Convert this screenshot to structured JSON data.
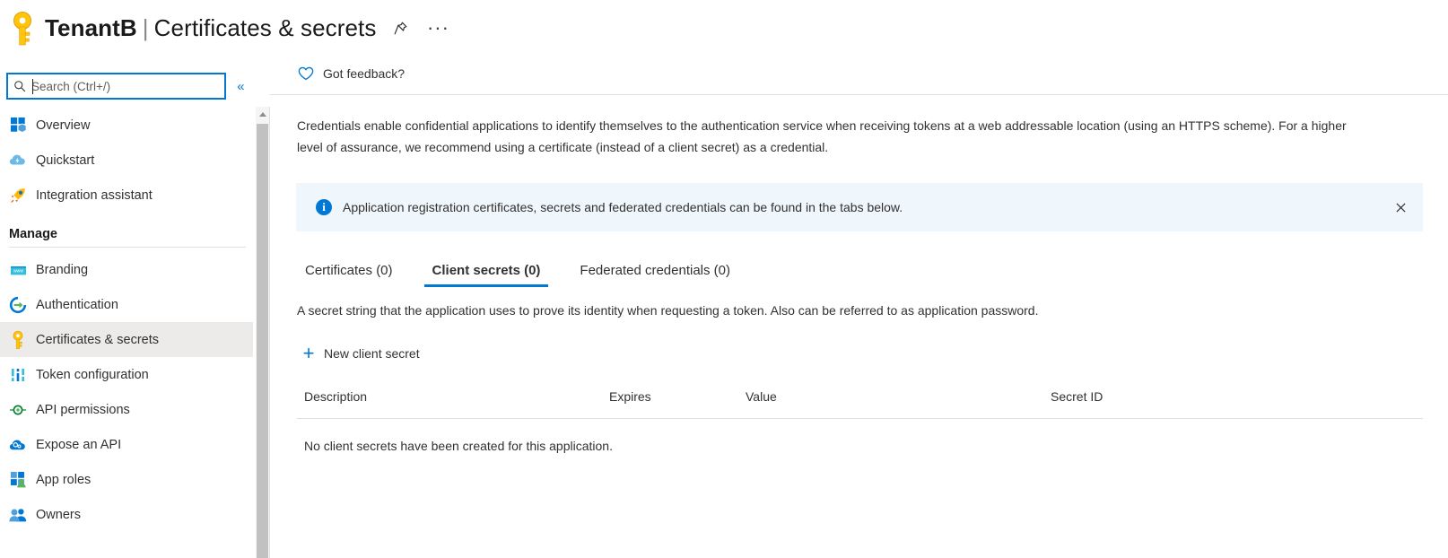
{
  "header": {
    "app_icon": "key-icon",
    "resource_name": "TenantB",
    "separator": "|",
    "page_name": "Certificates & secrets",
    "pin_icon": "pin-icon",
    "more_icon": "ellipsis-icon"
  },
  "sidebar": {
    "search": {
      "placeholder": "Search (Ctrl+/)",
      "value": "",
      "icon": "search-icon"
    },
    "collapse_icon": "chevron-double-left-icon",
    "items": [
      {
        "label": "Overview",
        "icon": "overview-grid-icon",
        "selected": false
      },
      {
        "label": "Quickstart",
        "icon": "cloud-lightning-icon",
        "selected": false
      },
      {
        "label": "Integration assistant",
        "icon": "rocket-icon",
        "selected": false
      }
    ],
    "group_label": "Manage",
    "manage_items": [
      {
        "label": "Branding",
        "icon": "browser-window-icon",
        "selected": false
      },
      {
        "label": "Authentication",
        "icon": "sign-in-arrow-icon",
        "selected": false
      },
      {
        "label": "Certificates & secrets",
        "icon": "key-icon",
        "selected": true
      },
      {
        "label": "Token configuration",
        "icon": "sliders-icon",
        "selected": false
      },
      {
        "label": "API permissions",
        "icon": "api-plug-icon",
        "selected": false
      },
      {
        "label": "Expose an API",
        "icon": "cloud-gear-icon",
        "selected": false
      },
      {
        "label": "App roles",
        "icon": "grid-person-icon",
        "selected": false
      },
      {
        "label": "Owners",
        "icon": "people-icon",
        "selected": false
      }
    ]
  },
  "main": {
    "feedback": {
      "label": "Got feedback?",
      "icon": "heart-icon"
    },
    "description": "Credentials enable confidential applications to identify themselves to the authentication service when receiving tokens at a web addressable location (using an HTTPS scheme). For a higher level of assurance, we recommend using a certificate (instead of a client secret) as a credential.",
    "info_banner": {
      "icon": "info-icon",
      "text": "Application registration certificates, secrets and federated credentials can be found in the tabs below.",
      "close_icon": "close-icon",
      "background_color": "#eff6fc"
    },
    "tabs": [
      {
        "label": "Certificates (0)",
        "active": false
      },
      {
        "label": "Client secrets (0)",
        "active": true
      },
      {
        "label": "Federated credentials (0)",
        "active": false
      }
    ],
    "tab_description": "A secret string that the application uses to prove its identity when requesting a token. Also can be referred to as application password.",
    "new_secret_button": {
      "label": "New client secret",
      "icon": "plus-icon"
    },
    "table": {
      "columns": [
        "Description",
        "Expires",
        "Value",
        "Secret ID"
      ],
      "rows": [],
      "empty_message": "No client secrets have been created for this application."
    }
  },
  "colors": {
    "accent": "#0078d4",
    "selected_nav": "#edebe9",
    "info_bg": "#eff6fc",
    "key_yellow": "#ffb900",
    "divider": "#e1dfdd"
  }
}
